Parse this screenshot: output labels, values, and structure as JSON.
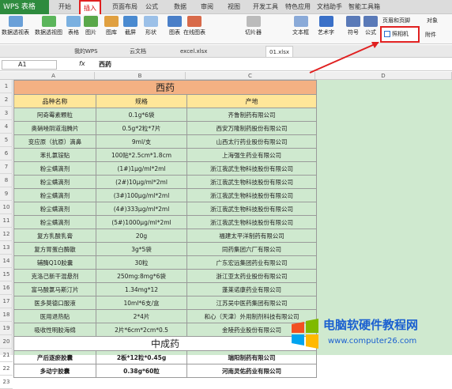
{
  "app": {
    "name": "WPS 表格"
  },
  "ribbon_tabs": [
    "开始",
    "插入",
    "页面布局",
    "公式",
    "数据",
    "审阅",
    "视图",
    "开发工具",
    "特色应用",
    "文档助手",
    "智能工具箱"
  ],
  "ribbon": {
    "buttons": [
      "数据透视表",
      "数据透视图",
      "表格",
      "图片",
      "图库",
      "截屏",
      "形状",
      "图表",
      "在线图表",
      "切片器",
      "文本框",
      "艺术字",
      "符号",
      "公式"
    ],
    "header_footer": "页眉和页脚",
    "object": "对象",
    "screenshot": "照相机",
    "attachment": "附件"
  },
  "doc_tabs": [
    "我的WPS",
    "云文档",
    "excel.xlsx",
    "01.xlsx"
  ],
  "formula_bar": {
    "cell": "A1",
    "fx": "fx",
    "value": "西药"
  },
  "columns": [
    "A",
    "B",
    "C",
    "D"
  ],
  "rows": [
    "1",
    "2",
    "3",
    "4",
    "5",
    "6",
    "7",
    "8",
    "9",
    "10",
    "11",
    "12",
    "13",
    "14",
    "15",
    "16",
    "17",
    "18",
    "19",
    "20",
    "21",
    "22",
    "23"
  ],
  "sheet": {
    "title": "西药",
    "headers": [
      "品种名称",
      "规格",
      "产地"
    ],
    "items": [
      [
        "阿奇霉素颗粒",
        "0.1g*6袋",
        "齐鲁制药有限公司"
      ],
      [
        "奥硝唑阴道泡腾片",
        "0.5g*2粒*7片",
        "西安万隆制药股份有限公司"
      ],
      [
        "变应原（抗原）滴鼻",
        "9ml/支",
        "山西太行药业股份有限公司"
      ],
      [
        "苯扎氯铵贴",
        "100贴*2.5cm*1.8cm",
        "上海强生药业有限公司"
      ],
      [
        "粉尘螨滴剂",
        "(1#)1μg/ml*2ml",
        "浙江我武生物科技股份有限公司"
      ],
      [
        "粉尘螨滴剂",
        "(2#)10μg/ml*2ml",
        "浙江我武生物科技股份有限公司"
      ],
      [
        "粉尘螨滴剂",
        "(3#)100μg/ml*2ml",
        "浙江我武生物科技股份有限公司"
      ],
      [
        "粉尘螨滴剂",
        "(4#)333μg/ml*2ml",
        "浙江我武生物科技股份有限公司"
      ],
      [
        "粉尘螨滴剂",
        "(5#)1000μg/ml*2ml",
        "浙江我武生物科技股份有限公司"
      ],
      [
        "复方乳酸乳膏",
        "20g",
        "福建太平洋制药有限公司"
      ],
      [
        "复方胃蛋白酶散",
        "3g*5袋",
        "同药集团六厂有限公司"
      ],
      [
        "辅酶Q10胶囊",
        "30粒",
        "广东宏远集团药业有限公司"
      ],
      [
        "克洛己新干混悬剂",
        "250mg:8mg*6袋",
        "浙江亚太药业股份有限公司"
      ],
      [
        "富马酸氯马斯汀片",
        "1.34mg*12",
        "蓬莱诺康药业有限公司"
      ],
      [
        "医多莫德口服液",
        "10ml*6支/盒",
        "江苏吴中医药集团有限公司"
      ],
      [
        "医用退热贴",
        "2*4片",
        "和心（天津）外用制剂科技有限公司"
      ],
      [
        "吸收性明胶海绵",
        "2片*6cm*2cm*0.5",
        "金陵药业股份有限公司"
      ]
    ],
    "section2_title": "中成药",
    "items2": [
      [
        "产后逐瘀胶囊",
        "2板*12粒*0.45g",
        "瑞阳制药有限公司"
      ],
      [
        "多动宁胶囊",
        "0.38g*60粒",
        "河南灵佑药业有限公司"
      ]
    ]
  },
  "watermark": {
    "title": "电脑软硬件教程网",
    "url": "www.computer26.com"
  },
  "colors": {
    "accent": "#2e8b3e",
    "highlight": "#e02020",
    "title_fill": "#f4b183",
    "header_fill": "#ffe699",
    "cell_fill": "#cfe9cf"
  }
}
